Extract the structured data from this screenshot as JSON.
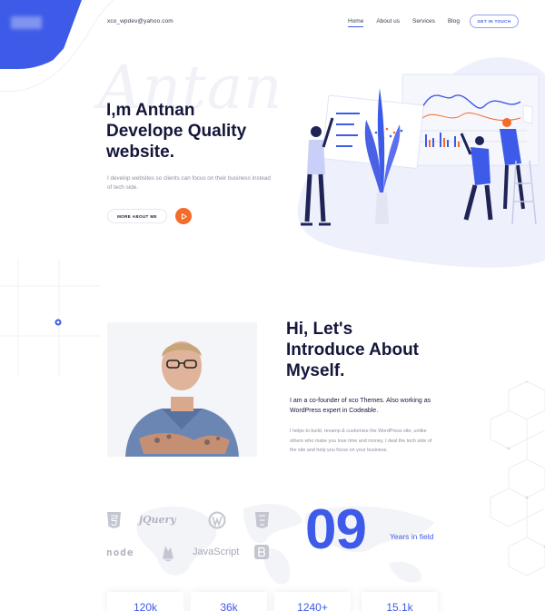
{
  "header": {
    "email": "xco_wpdev@yahoo.com",
    "nav": [
      {
        "label": "Home",
        "active": true
      },
      {
        "label": "About us",
        "active": false
      },
      {
        "label": "Services",
        "active": false
      },
      {
        "label": "Blog",
        "active": false
      }
    ],
    "cta_label": "GET IN TOUCH"
  },
  "hero": {
    "ghost_text": "Antan",
    "title_line1": "I,m Antnan",
    "title_line2": "Develope Quality",
    "title_line3": "website.",
    "subtitle": "I develop websites so clients can focus on their business instead of tech side.",
    "more_button": "MORE ABOUT ME",
    "play_icon": "play-icon"
  },
  "about": {
    "title_line1": "Hi, Let's",
    "title_line2": "Introduce About",
    "title_line3": "Myself.",
    "lead": "I am a co-founder of xco Themes. Also working as WordPress expert in Codeable.",
    "body": "I helps to build, revamp & customize the WordPress site, unlike others who make you lose time and money, I deal the tech side of the site and help you focus on your business."
  },
  "skills": {
    "logos": [
      "html5-icon",
      "jQuery",
      "wordpress-icon",
      "css3-icon",
      "node",
      "firebase-icon",
      "JavaScript",
      "bootstrap-icon"
    ],
    "years_number": "09",
    "years_label": "Years in field"
  },
  "stats": [
    "120k",
    "36k",
    "1240+",
    "15.1k"
  ],
  "colors": {
    "accent": "#3d5be8",
    "orange": "#f46b2a",
    "dark": "#14163a",
    "muted": "#8c8fa3"
  }
}
